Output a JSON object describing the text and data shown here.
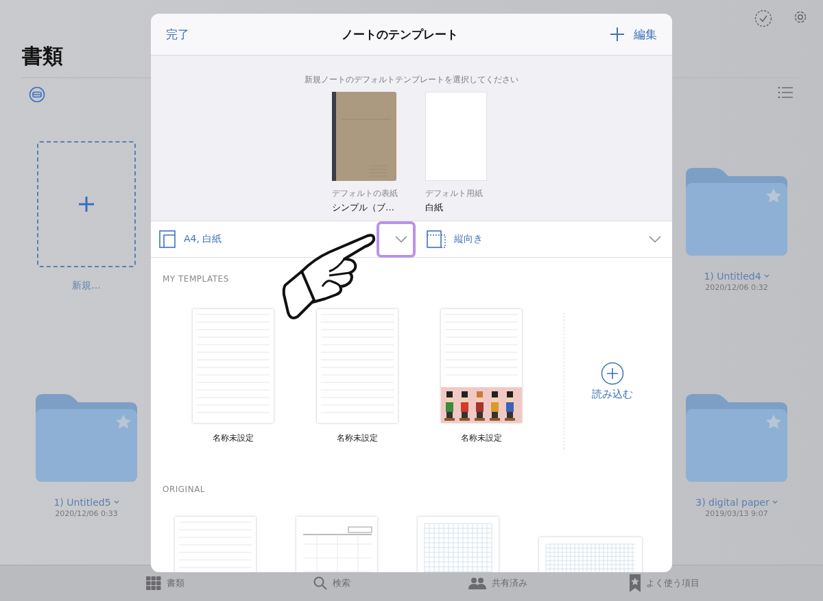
{
  "background": {
    "title": "書類",
    "new_item": {
      "label": "新規..."
    },
    "left_folders": [
      {
        "name": "1) Untitled5",
        "date": "2020/12/06 0:33"
      }
    ],
    "right_folders": [
      {
        "name": "1) Untitled4",
        "date": "2020/12/06 0:32"
      },
      {
        "name": "3) digital paper",
        "date": "2019/03/13 9:07"
      }
    ]
  },
  "tab_bar": [
    {
      "kind": "documents",
      "label": "書類"
    },
    {
      "kind": "search",
      "label": "検索"
    },
    {
      "kind": "shared",
      "label": "共有済み"
    },
    {
      "kind": "favorites",
      "label": "よく使う項目"
    }
  ],
  "modal": {
    "done": "完了",
    "title": "ノートのテンプレート",
    "edit": "編集",
    "prompt": "新規ノートのデフォルトテンプレートを選択してください",
    "defaults": [
      {
        "kind": "cover",
        "caption": "デフォルトの表紙",
        "value": "シンプル（ブ…"
      },
      {
        "kind": "paper",
        "caption": "デフォルト用紙",
        "value": "白紙"
      }
    ],
    "size_selector": "A4, 白紙",
    "orientation_selector": "縦向き",
    "my_templates": {
      "heading": "MY TEMPLATES",
      "import_label": "読み込む",
      "templates": [
        {
          "kind": "lined",
          "name": "名称未設定"
        },
        {
          "kind": "lined",
          "name": "名称未設定"
        },
        {
          "kind": "illustrated",
          "name": "名称未設定"
        }
      ]
    },
    "original": {
      "heading": "ORIGINAL",
      "templates": [
        {
          "kind": "lined"
        },
        {
          "kind": "form"
        },
        {
          "kind": "grid"
        },
        {
          "kind": "wide-grid"
        }
      ]
    }
  }
}
